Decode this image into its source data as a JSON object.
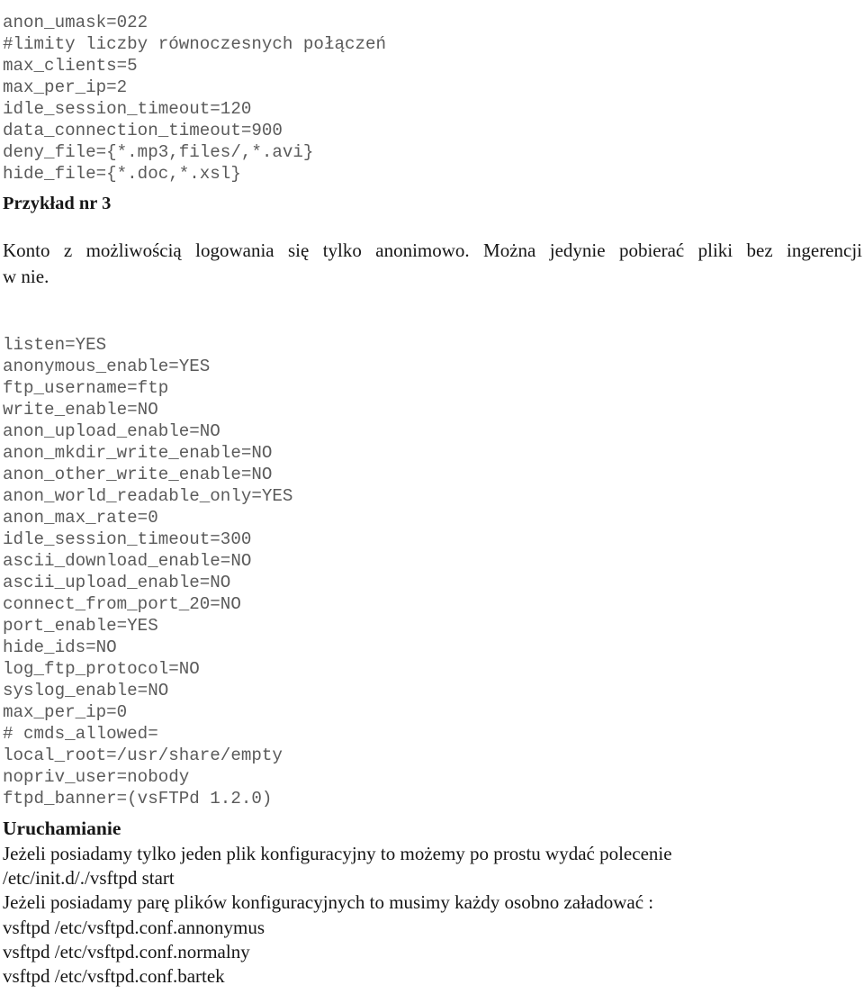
{
  "document": {
    "language": "pl",
    "text_color": "#161616",
    "code_color": "#5a5a5a",
    "background": "#ffffff"
  },
  "code_top": {
    "lines": [
      "anon_umask=022",
      "#limity liczby równoczesnych połączeń",
      "max_clients=5",
      "max_per_ip=2",
      "idle_session_timeout=120",
      "data_connection_timeout=900",
      "deny_file={*.mp3,files/,*.avi}",
      "hide_file={*.doc,*.xsl}"
    ]
  },
  "heading_przyklad": "Przykład nr 3",
  "para_konto": {
    "line1": "Konto z możliwością logowania się tylko anonimowo. Można jedynie pobierać pliki bez ingerencji",
    "line2": "w nie."
  },
  "code_main": {
    "lines": [
      "listen=YES",
      "anonymous_enable=YES",
      "ftp_username=ftp",
      "write_enable=NO",
      "anon_upload_enable=NO",
      "anon_mkdir_write_enable=NO",
      "anon_other_write_enable=NO",
      "anon_world_readable_only=YES",
      "anon_max_rate=0",
      "idle_session_timeout=300",
      "ascii_download_enable=NO",
      "ascii_upload_enable=NO",
      "connect_from_port_20=NO",
      "port_enable=YES",
      "hide_ids=NO",
      "log_ftp_protocol=NO",
      "syslog_enable=NO",
      "max_per_ip=0",
      "# cmds_allowed=",
      "local_root=/usr/share/empty",
      "nopriv_user=nobody",
      "ftpd_banner=(vsFTPd 1.2.0)"
    ]
  },
  "heading_uruchamianie": "Uruchamianie",
  "bottom_text": {
    "lines": [
      "Jeżeli posiadamy tylko jeden plik konfiguracyjny to możemy po prostu wydać polecenie",
      "/etc/init.d/./vsftpd start",
      "Jeżeli posiadamy parę plików konfiguracyjnych to musimy każdy osobno załadować :",
      "vsftpd /etc/vsftpd.conf.annonymus",
      "vsftpd /etc/vsftpd.conf.normalny",
      "vsftpd /etc/vsftpd.conf.bartek"
    ]
  }
}
